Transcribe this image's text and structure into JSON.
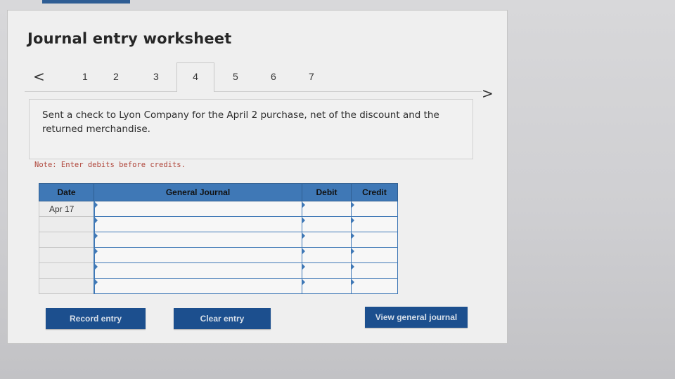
{
  "title": "Journal entry worksheet",
  "nav": {
    "prev_glyph": "<",
    "next_glyph": ">",
    "tabs": [
      "1",
      "2",
      "3",
      "4",
      "5",
      "6",
      "7"
    ],
    "active_tab": "4"
  },
  "description": "Sent a check to Lyon Company for the April 2 purchase, net of the discount and the returned merchandise.",
  "note": "Note: Enter debits before credits.",
  "table": {
    "headers": {
      "date": "Date",
      "general_journal": "General Journal",
      "debit": "Debit",
      "credit": "Credit"
    },
    "rows": [
      {
        "date": "Apr 17",
        "account": "",
        "debit": "",
        "credit": ""
      },
      {
        "date": "",
        "account": "",
        "debit": "",
        "credit": ""
      },
      {
        "date": "",
        "account": "",
        "debit": "",
        "credit": ""
      },
      {
        "date": "",
        "account": "",
        "debit": "",
        "credit": ""
      },
      {
        "date": "",
        "account": "",
        "debit": "",
        "credit": ""
      },
      {
        "date": "",
        "account": "",
        "debit": "",
        "credit": ""
      }
    ]
  },
  "buttons": {
    "record": "Record entry",
    "clear": "Clear entry",
    "view": "View general journal"
  },
  "colors": {
    "header_blue": "#3f78b6",
    "button_navy": "#1c4f8e",
    "note_red": "#b0463b"
  }
}
